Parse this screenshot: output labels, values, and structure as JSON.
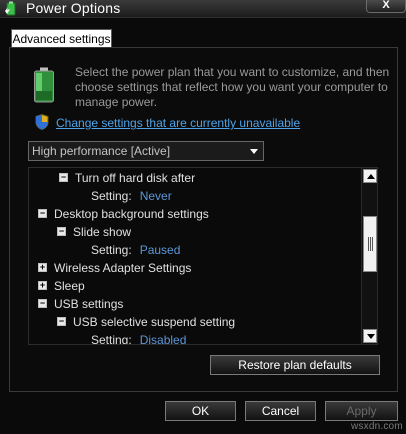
{
  "window": {
    "title": "Power Options",
    "close_label": "X",
    "app_icon": "power-options-icon"
  },
  "tabs": [
    {
      "label": "Advanced settings"
    }
  ],
  "intro": {
    "text": "Select the power plan that you want to customize, and then choose settings that reflect how you want your computer to manage power.",
    "icon": "battery-icon"
  },
  "change_link": {
    "text": "Change settings that are currently unavailable",
    "icon": "shield-icon"
  },
  "plan_select": {
    "value": "High performance [Active]"
  },
  "tree": {
    "setting_label": "Setting:",
    "rows": [
      {
        "toggle": "−",
        "label": "Turn off hard disk after"
      },
      {
        "setting_value": "Never"
      },
      {
        "toggle": "−",
        "label": "Desktop background settings"
      },
      {
        "toggle": "−",
        "label": "Slide show"
      },
      {
        "setting_value": "Paused"
      },
      {
        "toggle": "+",
        "label": "Wireless Adapter Settings"
      },
      {
        "toggle": "+",
        "label": "Sleep"
      },
      {
        "toggle": "−",
        "label": "USB settings"
      },
      {
        "toggle": "−",
        "label": "USB selective suspend setting"
      },
      {
        "setting_value": "Disabled"
      }
    ]
  },
  "buttons": {
    "restore": "Restore plan defaults",
    "ok": "OK",
    "cancel": "Cancel",
    "apply": "Apply"
  },
  "watermark": "wsxdn.com",
  "colors": {
    "link": "#4fa3e8",
    "setting_value": "#5d97d6",
    "background": "#0a0a0a"
  }
}
